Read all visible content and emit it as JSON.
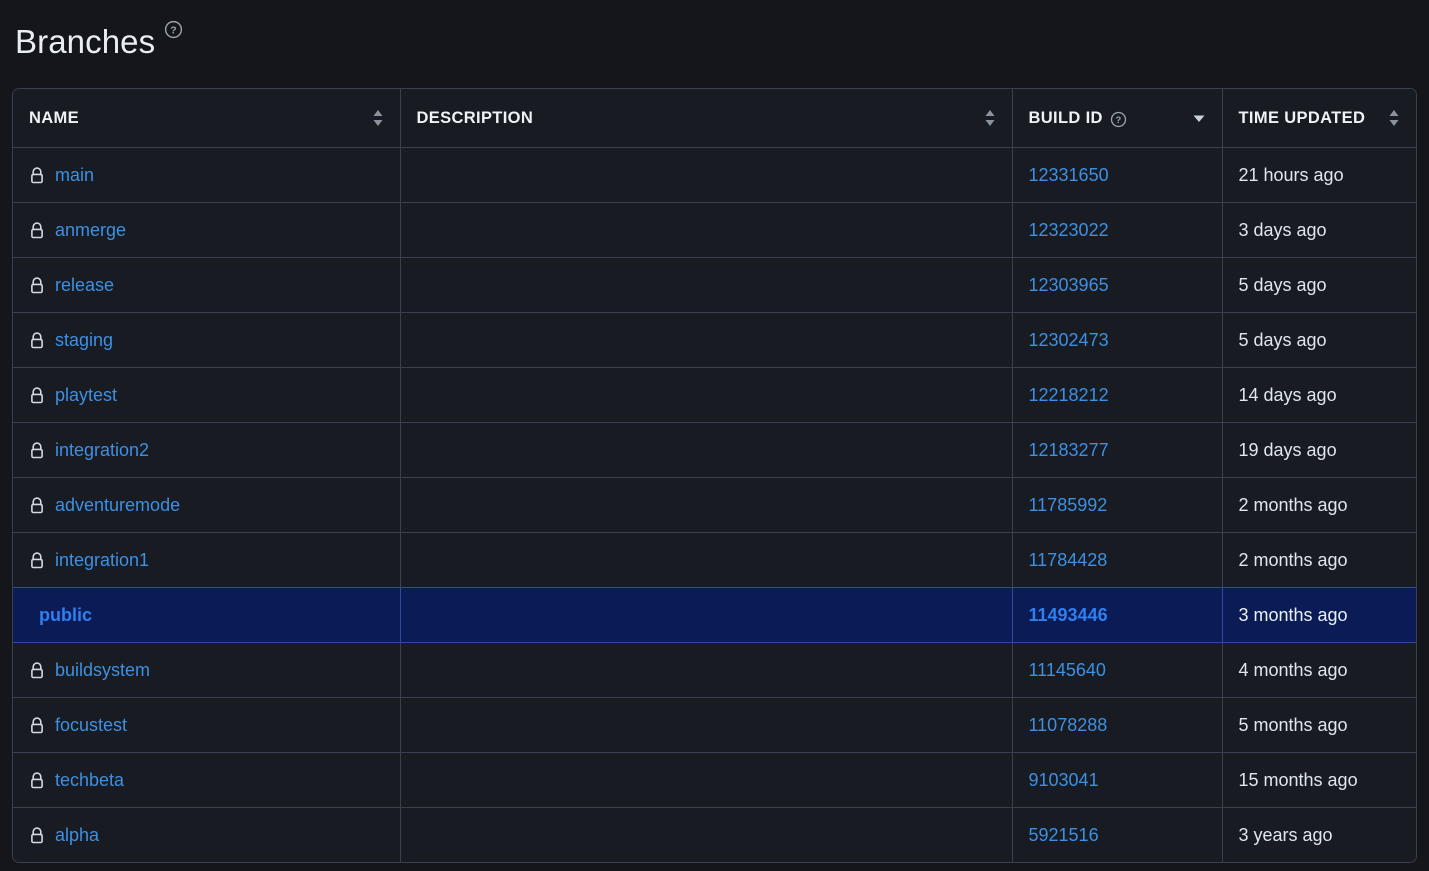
{
  "header": {
    "title": "Branches",
    "help_icon": "question-circle-icon"
  },
  "table": {
    "columns": [
      {
        "key": "name",
        "label": "NAME",
        "sort": "none",
        "sort_icon": "sort-both-icon",
        "help": false
      },
      {
        "key": "desc",
        "label": "DESCRIPTION",
        "sort": "none",
        "sort_icon": "sort-both-icon",
        "help": false
      },
      {
        "key": "build",
        "label": "BUILD ID",
        "sort": "desc",
        "sort_icon": "sort-descending-icon",
        "help": true,
        "help_icon": "question-circle-icon"
      },
      {
        "key": "time",
        "label": "TIME UPDATED",
        "sort": "none",
        "sort_icon": "sort-both-icon",
        "help": false
      }
    ],
    "rows": [
      {
        "name": "main",
        "locked": true,
        "description": "",
        "build_id": "12331650",
        "time_updated": "21 hours ago",
        "selected": false
      },
      {
        "name": "anmerge",
        "locked": true,
        "description": "",
        "build_id": "12323022",
        "time_updated": "3 days ago",
        "selected": false
      },
      {
        "name": "release",
        "locked": true,
        "description": "",
        "build_id": "12303965",
        "time_updated": "5 days ago",
        "selected": false
      },
      {
        "name": "staging",
        "locked": true,
        "description": "",
        "build_id": "12302473",
        "time_updated": "5 days ago",
        "selected": false
      },
      {
        "name": "playtest",
        "locked": true,
        "description": "",
        "build_id": "12218212",
        "time_updated": "14 days ago",
        "selected": false
      },
      {
        "name": "integration2",
        "locked": true,
        "description": "",
        "build_id": "12183277",
        "time_updated": "19 days ago",
        "selected": false
      },
      {
        "name": "adventuremode",
        "locked": true,
        "description": "",
        "build_id": "11785992",
        "time_updated": "2 months ago",
        "selected": false
      },
      {
        "name": "integration1",
        "locked": true,
        "description": "",
        "build_id": "11784428",
        "time_updated": "2 months ago",
        "selected": false
      },
      {
        "name": "public",
        "locked": false,
        "description": "",
        "build_id": "11493446",
        "time_updated": "3 months ago",
        "selected": true
      },
      {
        "name": "buildsystem",
        "locked": true,
        "description": "",
        "build_id": "11145640",
        "time_updated": "4 months ago",
        "selected": false
      },
      {
        "name": "focustest",
        "locked": true,
        "description": "",
        "build_id": "11078288",
        "time_updated": "5 months ago",
        "selected": false
      },
      {
        "name": "techbeta",
        "locked": true,
        "description": "",
        "build_id": "9103041",
        "time_updated": "15 months ago",
        "selected": false
      },
      {
        "name": "alpha",
        "locked": true,
        "description": "",
        "build_id": "5921516",
        "time_updated": "3 years ago",
        "selected": false
      }
    ]
  },
  "colors": {
    "page_background": "#14161b",
    "table_background": "#181b21",
    "border": "#39404f",
    "link": "#3d90e3",
    "selected_row_background": "#0b1b56",
    "selected_row_link": "#2f7ff0",
    "text": "#dfe6ee",
    "icon": "#c9d1d9"
  }
}
